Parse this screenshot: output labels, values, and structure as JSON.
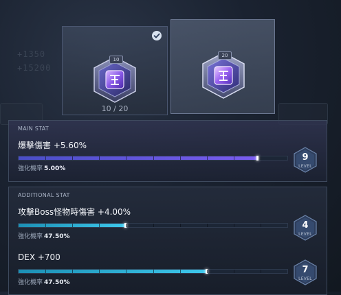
{
  "background": {
    "ghost_line_1": "+1350",
    "ghost_line_2": "+15200"
  },
  "cards": {
    "left": {
      "level": "10",
      "progress": "10 / 20",
      "selected": true,
      "symbol": "cube-icon"
    },
    "right": {
      "level": "20",
      "symbol": "cube-icon"
    }
  },
  "main_stat": {
    "title": "MAIN STAT",
    "name": "爆擊傷害 +5.60%",
    "chance_label": "強化機率",
    "chance_value": "5.00%",
    "progress_fraction": 0.89,
    "level": "9",
    "level_label": "LEVEL"
  },
  "additional_stat": {
    "title": "ADDITIONAL STAT",
    "items": [
      {
        "name": "攻擊Boss怪物時傷害 +4.00%",
        "chance_label": "強化機率",
        "chance_value": "47.50%",
        "progress_fraction": 0.4,
        "level": "4",
        "level_label": "LEVEL"
      },
      {
        "name": "DEX +700",
        "chance_label": "強化機率",
        "chance_value": "47.50%",
        "progress_fraction": 0.7,
        "level": "7",
        "level_label": "LEVEL"
      }
    ]
  },
  "colors": {
    "main_bar": "#6a56e8",
    "additional_bar": "#3ec8ec",
    "level_badge": "#3a4c6c"
  }
}
